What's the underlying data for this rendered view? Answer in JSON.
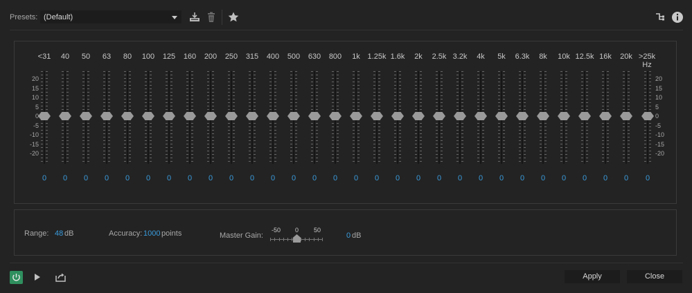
{
  "toolbar": {
    "presets_label": "Presets:",
    "preset_value": "(Default)",
    "icons": [
      "save-preset-icon",
      "delete-preset-icon",
      "favorite-star-icon",
      "routing-icon",
      "info-icon"
    ]
  },
  "eq": {
    "bands": [
      {
        "label": "<31",
        "value": "0"
      },
      {
        "label": "40",
        "value": "0"
      },
      {
        "label": "50",
        "value": "0"
      },
      {
        "label": "63",
        "value": "0"
      },
      {
        "label": "80",
        "value": "0"
      },
      {
        "label": "100",
        "value": "0"
      },
      {
        "label": "125",
        "value": "0"
      },
      {
        "label": "160",
        "value": "0"
      },
      {
        "label": "200",
        "value": "0"
      },
      {
        "label": "250",
        "value": "0"
      },
      {
        "label": "315",
        "value": "0"
      },
      {
        "label": "400",
        "value": "0"
      },
      {
        "label": "500",
        "value": "0"
      },
      {
        "label": "630",
        "value": "0"
      },
      {
        "label": "800",
        "value": "0"
      },
      {
        "label": "1k",
        "value": "0"
      },
      {
        "label": "1.25k",
        "value": "0"
      },
      {
        "label": "1.6k",
        "value": "0"
      },
      {
        "label": "2k",
        "value": "0"
      },
      {
        "label": "2.5k",
        "value": "0"
      },
      {
        "label": "3.2k",
        "value": "0"
      },
      {
        "label": "4k",
        "value": "0"
      },
      {
        "label": "5k",
        "value": "0"
      },
      {
        "label": "6.3k",
        "value": "0"
      },
      {
        "label": "8k",
        "value": "0"
      },
      {
        "label": "10k",
        "value": "0"
      },
      {
        "label": "12.5k",
        "value": "0"
      },
      {
        "label": "16k",
        "value": "0"
      },
      {
        "label": "20k",
        "value": "0"
      },
      {
        "label": ">25k Hz",
        "value": "0"
      }
    ],
    "scale_left": [
      "20",
      "15",
      "10",
      "5",
      "0",
      "-5",
      "-10",
      "-15",
      "-20"
    ],
    "scale_right": [
      "20",
      "15",
      "10",
      "5",
      "0",
      "-5",
      "-10",
      "-15",
      "-20"
    ]
  },
  "settings": {
    "range_label": "Range:",
    "range_value": "48",
    "range_unit": "dB",
    "accuracy_label": "Accuracy:",
    "accuracy_value": "1000",
    "accuracy_unit": "points",
    "master_gain_label": "Master Gain:",
    "master_gain_min": "-50",
    "master_gain_mid": "0",
    "master_gain_max": "50",
    "master_gain_value": "0",
    "master_gain_unit": "dB"
  },
  "footer": {
    "apply_label": "Apply",
    "close_label": "Close"
  },
  "colors": {
    "accent_blue": "#3a9bdc",
    "power_green": "#2f8f5e",
    "background": "#232323"
  }
}
